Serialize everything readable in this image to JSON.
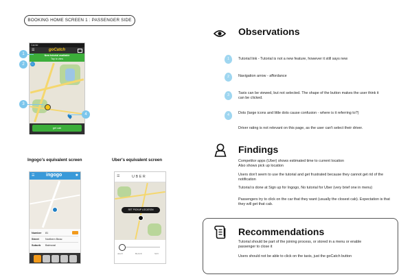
{
  "slide": {
    "title": "BOOKING HOME SCREEN 1 : PASSENGER SIDE"
  },
  "gocatch": {
    "carrier": "Carrier",
    "logo": "goCatch",
    "banner_line1": "New tutorial available",
    "banner_line2": "Tap to view",
    "book_button": "get cab",
    "callouts": [
      "1",
      "2",
      "3",
      "4"
    ]
  },
  "ingogo": {
    "caption": "Ingogo's equivalent screen",
    "logo": "ingogo",
    "rows": [
      {
        "label": "Number",
        "value": "81"
      },
      {
        "label": "Street",
        "value": "Northern Beac"
      },
      {
        "label": "Suburb",
        "value": "Balmoral"
      }
    ]
  },
  "uber": {
    "caption": "Uber's equivalent screen",
    "logo": "UBER",
    "pickup_button": "SET PICKUP LOCATION",
    "tabs": [
      "uberX",
      "BLACK",
      "SUV"
    ]
  },
  "observations": {
    "heading": "Observations",
    "items": [
      {
        "num": "1",
        "text": "Tutorial link - Tutorial is not a new feature, however it still says new"
      },
      {
        "num": "2",
        "text": "Navigation arrow - affordance"
      },
      {
        "num": "3",
        "text": "Taxis can be viewed, but not selected. The shape of the button makes the user think it can be clicked."
      },
      {
        "num": "4",
        "text": "Dots (large icons and little dots cause confusion - where is it referring to?)"
      }
    ],
    "note": "Driver rating is not relevant on this page, as the user can't select their driver."
  },
  "findings": {
    "heading": "Findings",
    "p1a": "Competitor apps (Uber) shows estimated time to current location",
    "p1b": "Also shows pick up location",
    "p2": "Users don't seem to use the tutorial and get frustrated because they cannot get rid of the notification",
    "p3": "Tutorial is done at Sign up for Ingogo, No tutorial for Uber (very brief one in menu)",
    "p4": "Passengers try to click on the car that they want (usually the closest cab). Expectation is that they will get that cab."
  },
  "recommendations": {
    "heading": "Recommendations",
    "p1": "Tutorial should be part of the joining process, or stored in a menu or enable passenger to close it",
    "p2": "Users should not be able to click on the taxis, just the goCatch button"
  },
  "colors": {
    "gocatch_green": "#3cae3a",
    "callout_blue": "#7cc6ec",
    "ingogo_blue": "#3a9ad9",
    "ingogo_orange": "#f29a1b"
  }
}
